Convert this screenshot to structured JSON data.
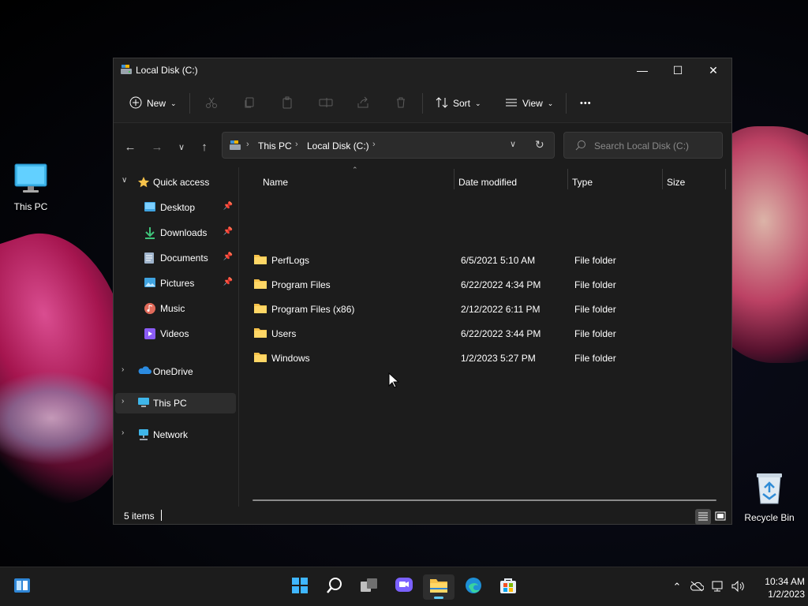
{
  "desktop": {
    "icons": [
      {
        "label": "This PC"
      },
      {
        "label": "Recycle Bin"
      }
    ]
  },
  "window": {
    "title": "Local Disk (C:)",
    "controls": {
      "minimize": "—",
      "maximize": "☐",
      "close": "✕"
    }
  },
  "toolbar": {
    "new_label": "New",
    "sort_label": "Sort",
    "view_label": "View",
    "more_label": "•••"
  },
  "address": {
    "segments": [
      "This PC",
      "Local Disk (C:)"
    ]
  },
  "search": {
    "placeholder": "Search Local Disk (C:)"
  },
  "sidebar": {
    "quick_access": "Quick access",
    "pinned": [
      {
        "label": "Desktop"
      },
      {
        "label": "Downloads"
      },
      {
        "label": "Documents"
      },
      {
        "label": "Pictures"
      },
      {
        "label": "Music"
      },
      {
        "label": "Videos"
      }
    ],
    "onedrive": "OneDrive",
    "this_pc": "This PC",
    "network": "Network"
  },
  "columns": {
    "name": "Name",
    "date": "Date modified",
    "type": "Type",
    "size": "Size"
  },
  "files": [
    {
      "name": "PerfLogs",
      "date": "6/5/2021 5:10 AM",
      "type": "File folder"
    },
    {
      "name": "Program Files",
      "date": "6/22/2022 4:34 PM",
      "type": "File folder"
    },
    {
      "name": "Program Files (x86)",
      "date": "2/12/2022 6:11 PM",
      "type": "File folder"
    },
    {
      "name": "Users",
      "date": "6/22/2022 3:44 PM",
      "type": "File folder"
    },
    {
      "name": "Windows",
      "date": "1/2/2023 5:27 PM",
      "type": "File folder"
    }
  ],
  "status": {
    "count": "5 items"
  },
  "clock": {
    "time": "10:34 AM",
    "date": "1/2/2023"
  },
  "colors": {
    "accent": "#60cdff",
    "folder": "#f6c24a",
    "window_bg": "#1c1c1c"
  }
}
